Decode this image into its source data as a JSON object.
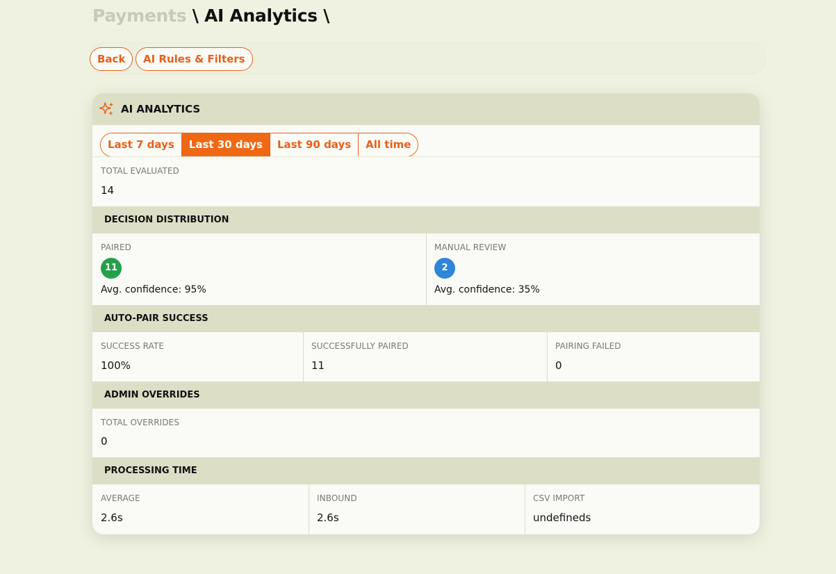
{
  "breadcrumb": {
    "parent": "Payments",
    "sep1": " \\ ",
    "current": "AI Analytics",
    "sep2": " \\"
  },
  "toolbar": {
    "back_label": "Back",
    "rules_label": "AI Rules & Filters"
  },
  "card": {
    "title": "AI ANALYTICS",
    "icon": "sparkle-icon",
    "ranges": [
      "Last 7 days",
      "Last 30 days",
      "Last 90 days",
      "All time"
    ],
    "selected_range": "Last 30 days",
    "total_evaluated": {
      "label": "TOTAL EVALUATED",
      "value": "14"
    },
    "decision": {
      "title": "DECISION DISTRIBUTION",
      "paired": {
        "label": "PAIRED",
        "count": "11",
        "confidence": "Avg. confidence: 95%",
        "color": "#22a04b"
      },
      "manual": {
        "label": "MANUAL REVIEW",
        "count": "2",
        "confidence": "Avg. confidence: 35%",
        "color": "#2f86d6"
      }
    },
    "autopair": {
      "title": "AUTO-PAIR SUCCESS",
      "success_rate": {
        "label": "SUCCESS RATE",
        "value": "100%"
      },
      "paired": {
        "label": "SUCCESSFULLY PAIRED",
        "value": "11"
      },
      "failed": {
        "label": "PAIRING FAILED",
        "value": "0"
      }
    },
    "overrides": {
      "title": "ADMIN OVERRIDES",
      "total": {
        "label": "TOTAL OVERRIDES",
        "value": "0"
      }
    },
    "processing": {
      "title": "PROCESSING TIME",
      "average": {
        "label": "AVERAGE",
        "value": "2.6s"
      },
      "inbound": {
        "label": "INBOUND",
        "value": "2.6s"
      },
      "csv": {
        "label": "CSV IMPORT",
        "value": "undefineds"
      }
    }
  },
  "colors": {
    "accent": "#e8601c",
    "accent_active": "#f06814",
    "band": "#dcdfc6",
    "background": "#f0f2e1"
  }
}
